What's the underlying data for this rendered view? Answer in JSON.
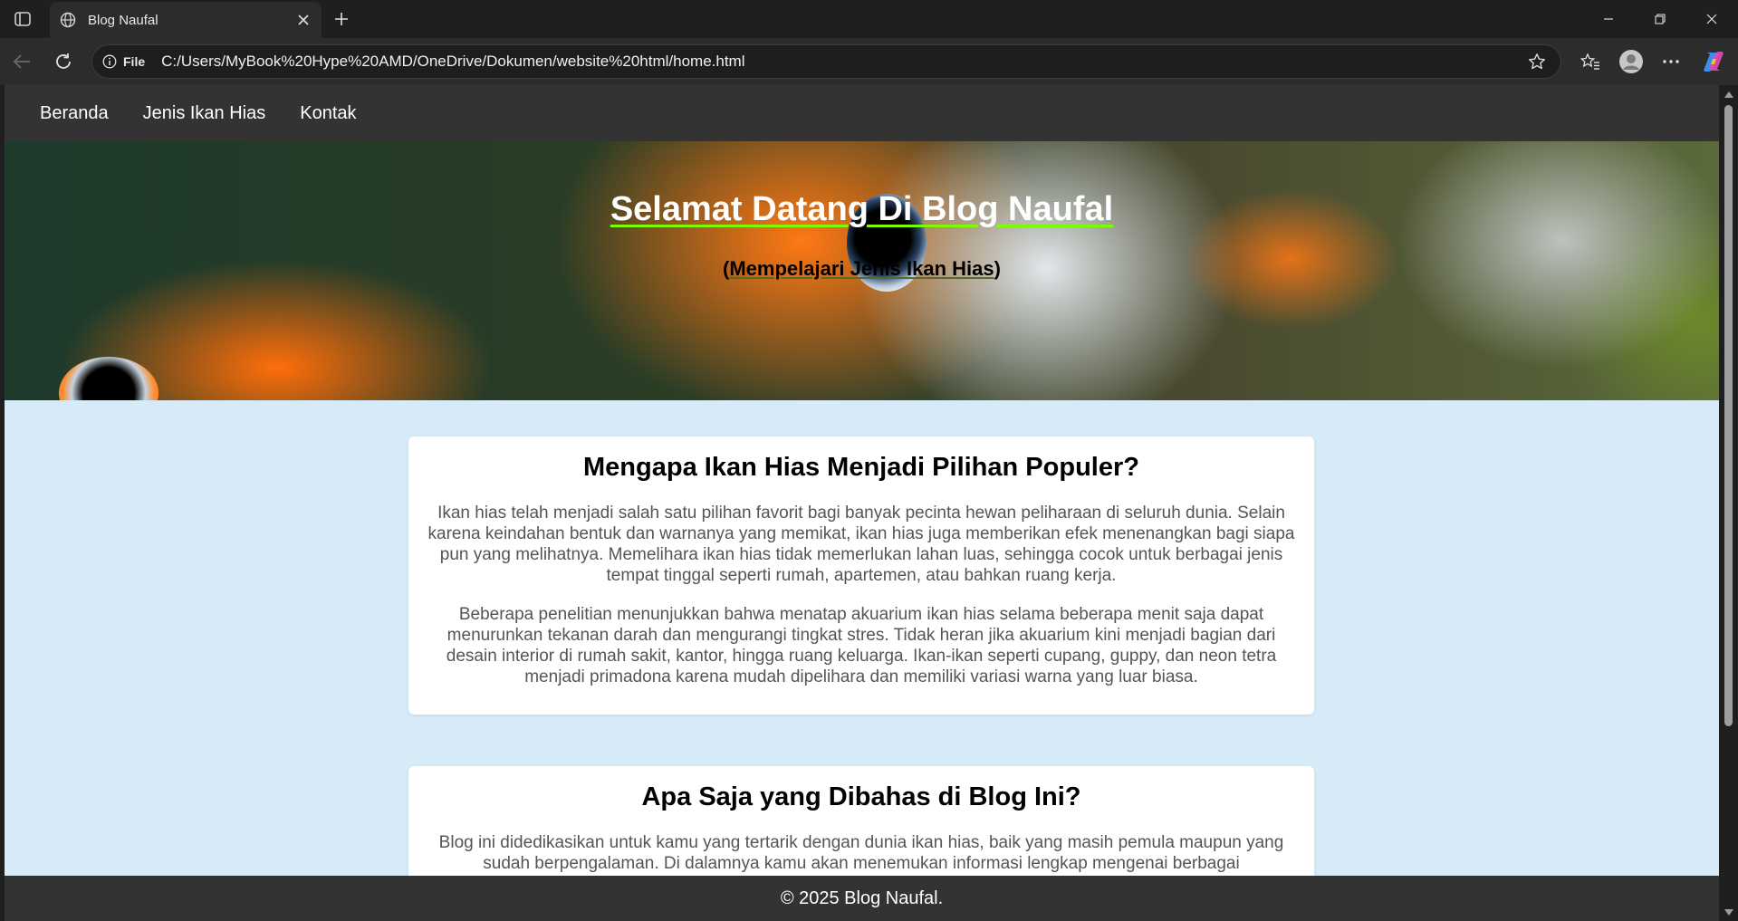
{
  "browser": {
    "tab_title": "Blog Naufal",
    "address_prefix": "File",
    "url": "C:/Users/MyBook%20Hype%20AMD/OneDrive/Dokumen/website%20html/home.html"
  },
  "nav": {
    "items": [
      {
        "label": "Beranda"
      },
      {
        "label": "Jenis Ikan Hias"
      },
      {
        "label": "Kontak"
      }
    ]
  },
  "hero": {
    "title": "Selamat Datang Di Blog Naufal",
    "subtitle_open": "(",
    "subtitle": "Mempelajari Jenis Ikan Hias",
    "subtitle_close": ")"
  },
  "sections": [
    {
      "heading": "Mengapa Ikan Hias Menjadi Pilihan Populer?",
      "paragraphs": [
        "Ikan hias telah menjadi salah satu pilihan favorit bagi banyak pecinta hewan peliharaan di seluruh dunia. Selain karena keindahan bentuk dan warnanya yang memikat, ikan hias juga memberikan efek menenangkan bagi siapa pun yang melihatnya. Memelihara ikan hias tidak memerlukan lahan luas, sehingga cocok untuk berbagai jenis tempat tinggal seperti rumah, apartemen, atau bahkan ruang kerja.",
        "Beberapa penelitian menunjukkan bahwa menatap akuarium ikan hias selama beberapa menit saja dapat menurunkan tekanan darah dan mengurangi tingkat stres. Tidak heran jika akuarium kini menjadi bagian dari desain interior di rumah sakit, kantor, hingga ruang keluarga. Ikan-ikan seperti cupang, guppy, dan neon tetra menjadi primadona karena mudah dipelihara dan memiliki variasi warna yang luar biasa."
      ]
    },
    {
      "heading": "Apa Saja yang Dibahas di Blog Ini?",
      "paragraphs": [
        "Blog ini didedikasikan untuk kamu yang tertarik dengan dunia ikan hias, baik yang masih pemula maupun yang sudah berpengalaman. Di dalamnya kamu akan menemukan informasi lengkap mengenai berbagai"
      ]
    }
  ],
  "footer": {
    "text": "© 2025 Blog Naufal."
  },
  "colors": {
    "nav_bg": "#333333",
    "page_bg": "#d6eaf8",
    "title_underline": "#7cfc00"
  },
  "icons": [
    "sidebar-toggle-icon",
    "globe-icon",
    "close-icon",
    "plus-icon",
    "minimize-icon",
    "restore-icon",
    "back-icon",
    "refresh-icon",
    "info-icon",
    "star-icon",
    "favorites-icon",
    "profile-icon",
    "more-icon",
    "copilot-icon"
  ]
}
